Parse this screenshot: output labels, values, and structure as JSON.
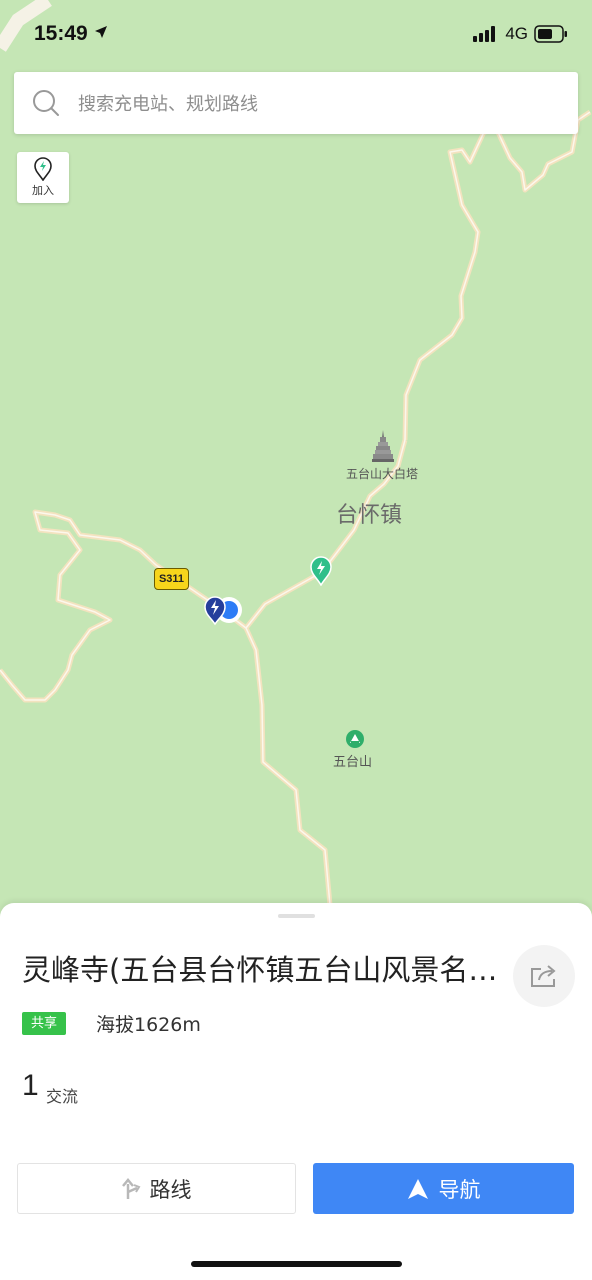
{
  "status_bar": {
    "time": "15:49",
    "network": "4G"
  },
  "search": {
    "placeholder": "搜索充电站、规划路线"
  },
  "map": {
    "add_button_label": "加入",
    "poi_pagoda": "五台山大白塔",
    "town": "台怀镇",
    "road_shield": "S311",
    "poi_mountain": "五台山"
  },
  "sheet": {
    "title": "灵峰寺(五台县台怀镇五台山风景名…",
    "badge": "共享",
    "elevation": "海拔1626m",
    "count": "1",
    "count_label": "交流",
    "route_label": "路线",
    "navigate_label": "导航"
  },
  "colors": {
    "accent": "#3f87f5",
    "badge": "#36c24a",
    "map_land": "#c5e6b5",
    "road": "#f6dcae"
  }
}
